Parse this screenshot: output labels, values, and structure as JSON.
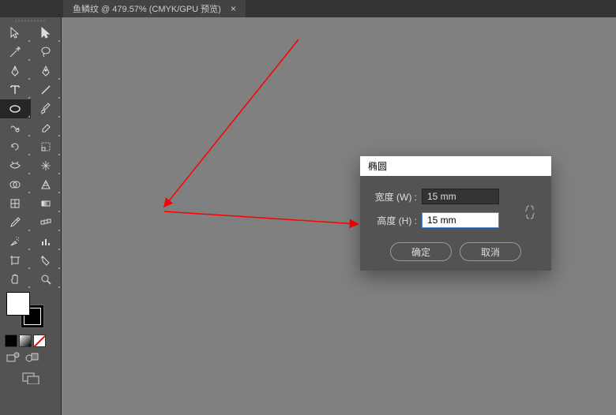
{
  "tab": {
    "title": "鱼鳞纹 @ 479.57% (CMYK/GPU 预览)",
    "close": "×"
  },
  "dialog": {
    "title": "椭圆",
    "width_label": "宽度 (W) :",
    "height_label": "高度 (H) :",
    "width_value": "15 mm",
    "height_value": "15 mm",
    "ok": "确定",
    "cancel": "取消"
  },
  "tools": [
    [
      "selection",
      "direct-selection"
    ],
    [
      "magic-wand",
      "lasso"
    ],
    [
      "pen",
      "curvature"
    ],
    [
      "type",
      "line-segment"
    ],
    [
      "ellipse",
      "paintbrush"
    ],
    [
      "shaper",
      "eraser"
    ],
    [
      "rotate",
      "scale"
    ],
    [
      "width",
      "free-transform"
    ],
    [
      "shape-builder",
      "perspective-grid"
    ],
    [
      "mesh",
      "gradient"
    ],
    [
      "eyedropper",
      "blend"
    ],
    [
      "symbol-sprayer",
      "column-graph"
    ],
    [
      "artboard",
      "slice"
    ],
    [
      "hand",
      "zoom"
    ]
  ]
}
